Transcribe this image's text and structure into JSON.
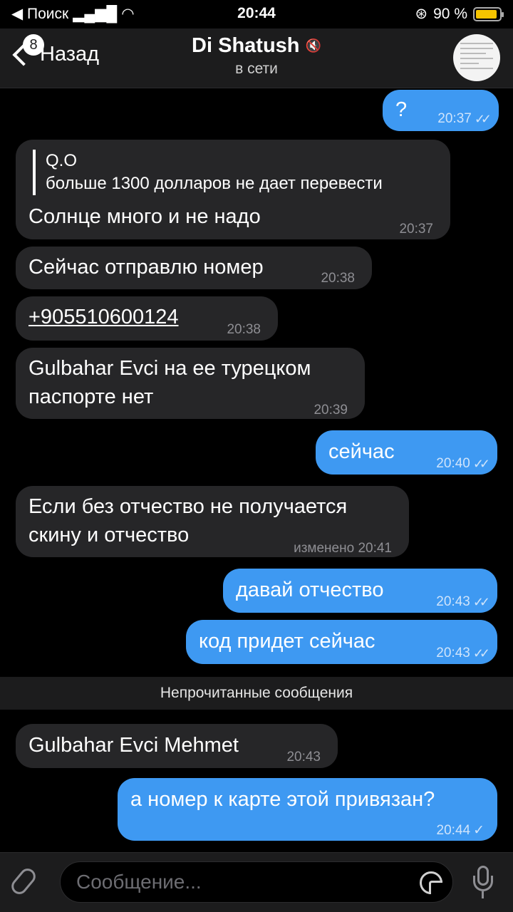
{
  "status_bar": {
    "carrier": "◀ Поиск",
    "time": "20:44",
    "battery_percent": "90 %",
    "battery_level": 0.9
  },
  "header": {
    "back_label": "Назад",
    "unread_badge": "8",
    "title": "Di Shatush",
    "subtitle": "в сети"
  },
  "messages": [
    {
      "dir": "out",
      "text": "?",
      "time": "20:37",
      "read": true
    },
    {
      "dir": "in",
      "reply_author": "Q.O",
      "reply_text": "больше 1300 долларов не дает перевести",
      "text": "Солнце много и не надо",
      "time": "20:37"
    },
    {
      "dir": "in",
      "text": "Сейчас отправлю номер",
      "time": "20:38"
    },
    {
      "dir": "in",
      "text": "+905510600124",
      "time": "20:38"
    },
    {
      "dir": "in",
      "text_line1": "Gulbahar Evci на ее турецком",
      "text_line2": "паспорте нет",
      "time": "20:39"
    },
    {
      "dir": "out",
      "text": "сейчас",
      "time": "20:40",
      "read": true
    },
    {
      "dir": "in",
      "text_line1": "Если без отчество не получается",
      "text_line2": "скину и отчество",
      "time": "изменено 20:41"
    },
    {
      "dir": "out",
      "text": "давай отчество",
      "time": "20:43",
      "read": true
    },
    {
      "dir": "out",
      "text": "код придет сейчас",
      "time": "20:43",
      "read": true
    },
    {
      "dir": "in",
      "text": "Gulbahar Evci Mehmet",
      "time": "20:43"
    },
    {
      "dir": "out",
      "text": "а номер к карте этой привязан?",
      "time": "20:44",
      "read": false
    }
  ],
  "unread_divider": "Непрочитанные сообщения",
  "input": {
    "placeholder": "Сообщение..."
  },
  "icons": {
    "attach": "paperclip-icon",
    "sticker": "sticker-icon",
    "mic": "microphone-icon",
    "mute": "muted-speaker-icon"
  }
}
